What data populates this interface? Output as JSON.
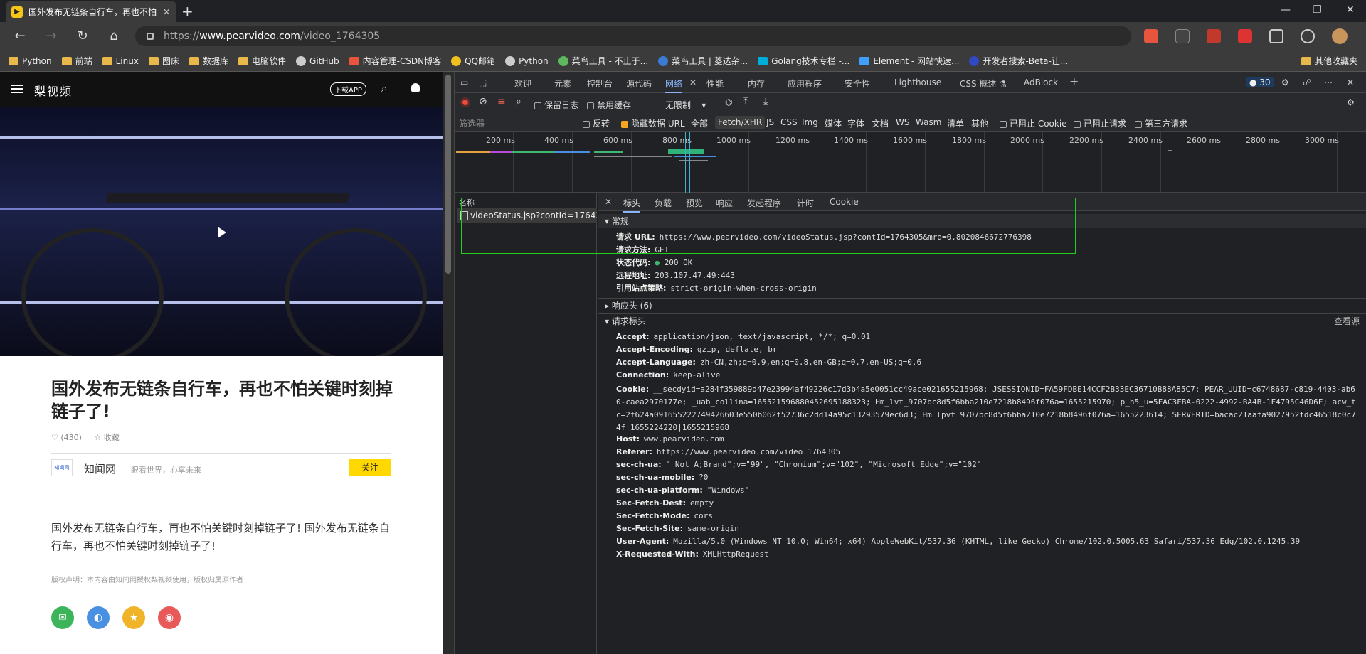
{
  "browser": {
    "tab_title": "国外发布无链条自行车，再也不怕",
    "tab_close": "×",
    "new_tab": "+",
    "url_prefix": "https://",
    "url_host": "www.pearvideo.com",
    "url_path": "/video_1764305",
    "window_controls": [
      "—",
      "❐",
      "✕"
    ]
  },
  "bookmarks": {
    "items": [
      {
        "label": "Python",
        "icon": "folder-icon"
      },
      {
        "label": "前端",
        "icon": "folder-icon"
      },
      {
        "label": "Linux",
        "icon": "folder-icon"
      },
      {
        "label": "图床",
        "icon": "folder-icon"
      },
      {
        "label": "数据库",
        "icon": "folder-icon"
      },
      {
        "label": "电脑软件",
        "icon": "folder-icon"
      },
      {
        "label": "GitHub",
        "icon": "github-icon"
      },
      {
        "label": "内容管理-CSDN博客",
        "icon": "csdn-icon"
      },
      {
        "label": "QQ邮箱",
        "icon": "qq-icon"
      },
      {
        "label": "Python",
        "icon": "python-icon"
      },
      {
        "label": "菜鸟工具 - 不止于...",
        "icon": "runoob-icon"
      },
      {
        "label": "菜鸟工具 | 菱达杂...",
        "icon": "runoob-icon"
      },
      {
        "label": "Golang技术专栏 -...",
        "icon": "golang-icon"
      },
      {
        "label": "Element - 网站快速...",
        "icon": "element-icon"
      },
      {
        "label": "开发者搜索-Beta-让...",
        "icon": "baidu-icon"
      }
    ],
    "other": "其他收藏夹"
  },
  "page": {
    "logo": "梨视频",
    "download": "下载APP",
    "title": "国外发布无链条自行车，再也不怕关键时刻掉链子了!",
    "likes": "♡ (430)",
    "fav": "☆ 收藏",
    "source_logo": "知闻网",
    "source_name": "知闻网",
    "source_slogan": "眼看世界，心享未来",
    "follow": "关注",
    "description": "国外发布无链条自行车，再也不怕关键时刻掉链子了! 国外发布无链条自行车，再也不怕关键时刻掉链子了!",
    "copyright": "版权声明：本内容由知闻网授权梨视频使用，版权归属原作者"
  },
  "devtools": {
    "tabs": [
      "欢迎",
      "元素",
      "控制台",
      "源代码",
      "网络",
      "性能",
      "内存",
      "应用程序",
      "安全性",
      "Lighthouse",
      "CSS 概述 ⚗",
      "AdBlock"
    ],
    "issues_count": "30",
    "toolbar": {
      "preserve_log": "保留日志",
      "disable_cache": "禁用缓存",
      "throttle": "无限制"
    },
    "filter": {
      "placeholder": "筛选器",
      "invert": "反转",
      "hide_data_url": "隐藏数据 URL",
      "types": [
        "全部",
        "Fetch/XHR",
        "JS",
        "CSS",
        "Img",
        "媒体",
        "字体",
        "文档",
        "WS",
        "Wasm",
        "清单",
        "其他"
      ],
      "blocked_cookies": "已阻止 Cookie",
      "blocked_requests": "已阻止请求",
      "third_party": "第三方请求"
    },
    "timeline_ticks": [
      "200 ms",
      "400 ms",
      "600 ms",
      "800 ms",
      "1000 ms",
      "1200 ms",
      "1400 ms",
      "1600 ms",
      "1800 ms",
      "2000 ms",
      "2200 ms",
      "2400 ms",
      "2600 ms",
      "2800 ms",
      "3000 ms"
    ],
    "name_header": "名称",
    "request_name": "videoStatus.jsp?contId=17643...",
    "detail_tabs": [
      "标头",
      "负载",
      "预览",
      "响应",
      "发起程序",
      "计时",
      "Cookie"
    ],
    "general": {
      "title": "常规",
      "rows": [
        {
          "k": "请求 URL:",
          "v": "https://www.pearvideo.com/videoStatus.jsp?contId=1764305&mrd=0.8020846672776398"
        },
        {
          "k": "请求方法:",
          "v": "GET"
        },
        {
          "k": "状态代码:",
          "v": "200 OK"
        },
        {
          "k": "远程地址:",
          "v": "203.107.47.49:443"
        },
        {
          "k": "引用站点策略:",
          "v": "strict-origin-when-cross-origin"
        }
      ]
    },
    "response_headers": "响应头 (6)",
    "request_headers": {
      "title": "请求标头",
      "view_source": "查看源",
      "rows": [
        {
          "k": "Accept:",
          "v": "application/json, text/javascript, */*; q=0.01"
        },
        {
          "k": "Accept-Encoding:",
          "v": "gzip, deflate, br"
        },
        {
          "k": "Accept-Language:",
          "v": "zh-CN,zh;q=0.9,en;q=0.8,en-GB;q=0.7,en-US;q=0.6"
        },
        {
          "k": "Connection:",
          "v": "keep-alive"
        },
        {
          "k": "Cookie:",
          "v": "__secdyid=a284f359889d47e23994af49226c17d3b4a5e0051cc49ace021655215968; JSESSIONID=FA59FDBE14CCF2B33EC36710B88A85C7; PEAR_UUID=c6748687-c819-4403-ab60-caea2970177e; _uab_collina=165521596880452695188323; Hm_lvt_9707bc8d5f6bba210e7218b8496f076a=1655215970; p_h5_u=5FAC3FBA-0222-4992-BA4B-1F4795C46D6F; acw_tc=2f624a091655222749426603e550b062f52736c2dd14a95c13293579ec6d3; Hm_lpvt_9707bc8d5f6bba210e7218b8496f076a=1655223614; SERVERID=bacac21aafa9027952fdc46518c0c74f|1655224220|1655215968"
        },
        {
          "k": "Host:",
          "v": "www.pearvideo.com"
        },
        {
          "k": "Referer:",
          "v": "https://www.pearvideo.com/video_1764305"
        },
        {
          "k": "sec-ch-ua:",
          "v": "\" Not A;Brand\";v=\"99\", \"Chromium\";v=\"102\", \"Microsoft Edge\";v=\"102\""
        },
        {
          "k": "sec-ch-ua-mobile:",
          "v": "?0"
        },
        {
          "k": "sec-ch-ua-platform:",
          "v": "\"Windows\""
        },
        {
          "k": "Sec-Fetch-Dest:",
          "v": "empty"
        },
        {
          "k": "Sec-Fetch-Mode:",
          "v": "cors"
        },
        {
          "k": "Sec-Fetch-Site:",
          "v": "same-origin"
        },
        {
          "k": "User-Agent:",
          "v": "Mozilla/5.0 (Windows NT 10.0; Win64; x64) AppleWebKit/537.36 (KHTML, like Gecko) Chrome/102.0.5005.63 Safari/537.36 Edg/102.0.1245.39"
        },
        {
          "k": "X-Requested-With:",
          "v": "XMLHttpRequest"
        }
      ]
    }
  }
}
